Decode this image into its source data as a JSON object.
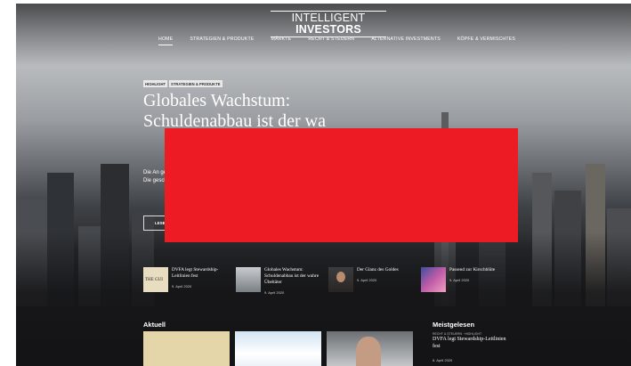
{
  "site": {
    "logo_light": "INTELLIGENT ",
    "logo_bold": "INVESTORS"
  },
  "nav": {
    "items": [
      {
        "label": "HOME"
      },
      {
        "label": "STRATEGIEN & PRODUKTE"
      },
      {
        "label": "MÄRKTE"
      },
      {
        "label": "RECHT & STEUERN"
      },
      {
        "label": "ALTERNATIVE INVESTMENTS"
      },
      {
        "label": "KÖPFE & VERMISCHTES"
      }
    ]
  },
  "hero": {
    "tags": [
      "HIGHLIGHT",
      "STRATEGIEN & PRODUKTE"
    ],
    "title": "Globales Wachstum: Schuldenabbau ist der wa",
    "excerpt": "Die An gen. Die gesch",
    "button": "LESE"
  },
  "featured": [
    {
      "title": "DVFA legt Stewardship-Leitlinien fest",
      "date": "9. April 2020",
      "thumb_text": "THE GUI"
    },
    {
      "title": "Globales Wachstum: Schuldenabbau ist der wahre Übeltäter",
      "date": "9. April 2020"
    },
    {
      "title": "Der Glanz des Goldes",
      "date": "9. April 2020"
    },
    {
      "title": "Passend zur Kirschblüte",
      "date": "9. April 2020"
    }
  ],
  "sections": {
    "aktuell": "Aktuell"
  },
  "popular": {
    "title": "Meistgelesen",
    "meta": "RECHT & STEUERN · HIGHLIGHT",
    "headline": "DVFA legt Stewardship-Leitlinien fest",
    "date": "6. April 2020"
  },
  "colors": {
    "redaction": "#ed1c24",
    "background_dark": "#141416"
  }
}
